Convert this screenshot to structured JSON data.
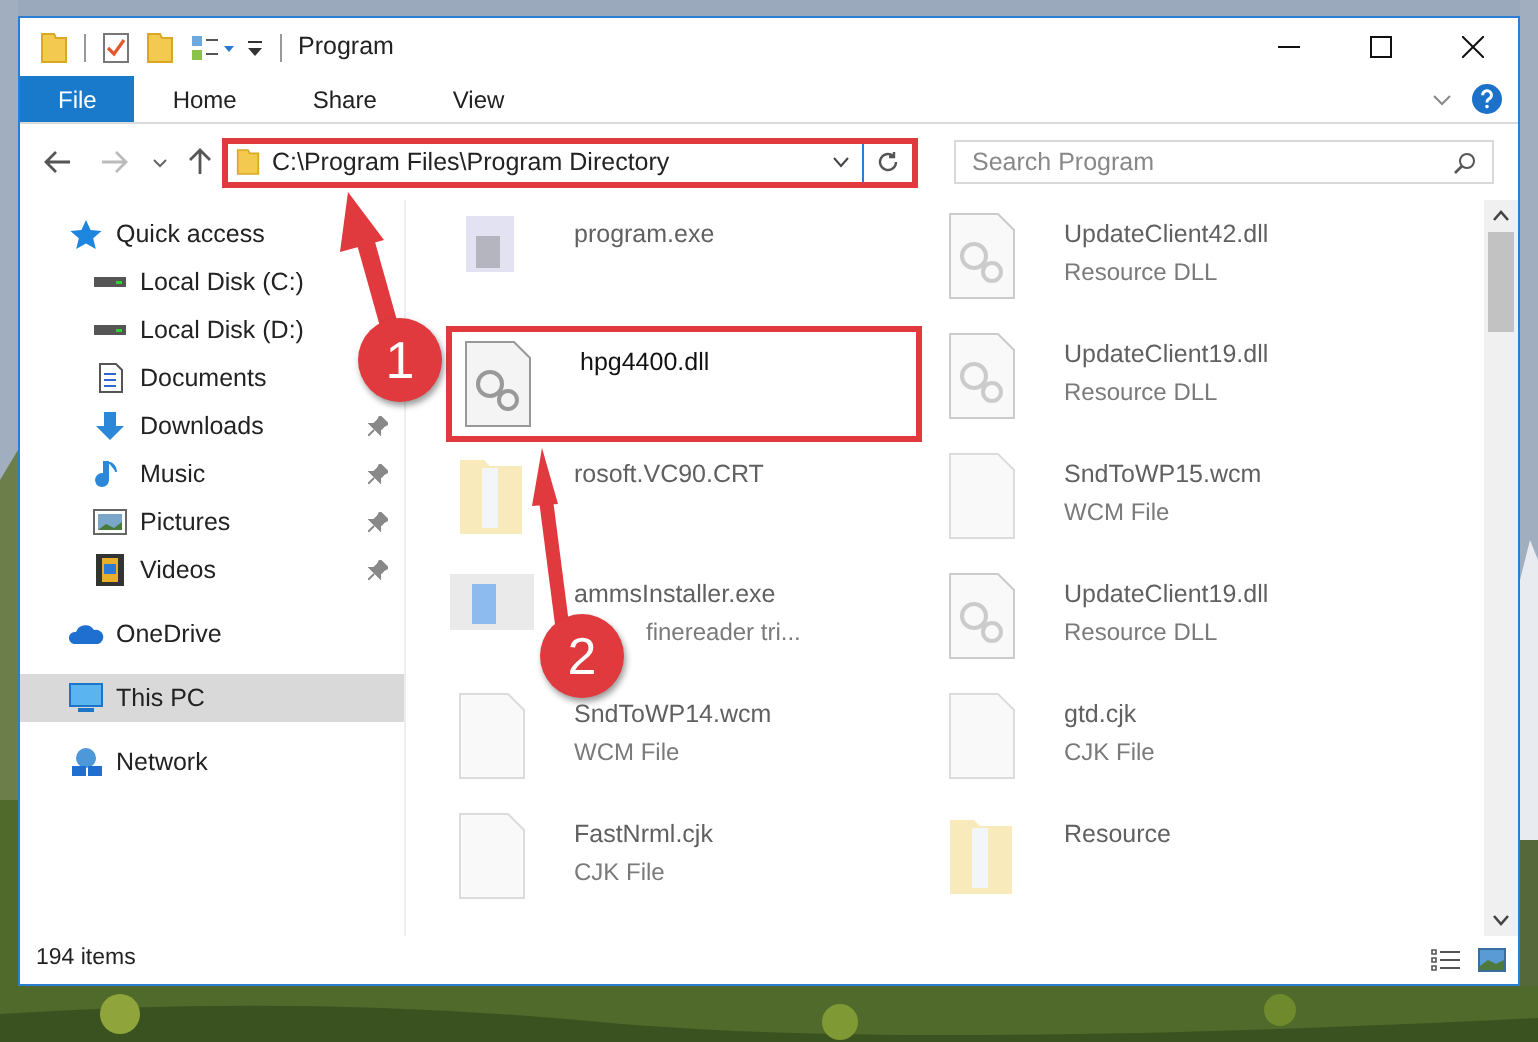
{
  "window": {
    "title": "Program"
  },
  "ribbon": {
    "tabs": [
      {
        "label": "File",
        "selected": true
      },
      {
        "label": "Home",
        "selected": false
      },
      {
        "label": "Share",
        "selected": false
      },
      {
        "label": "View",
        "selected": false
      }
    ]
  },
  "address_bar": {
    "path": "C:\\Program Files\\Program Directory",
    "highlighted": true
  },
  "search": {
    "placeholder": "Search Program"
  },
  "sidebar": {
    "items": [
      {
        "label": "Quick access",
        "selected": false,
        "children": [
          {
            "label": "Local Disk (C:)",
            "pinned": false,
            "selected": false
          },
          {
            "label": "Local Disk (D:)",
            "pinned": false,
            "selected": false
          },
          {
            "label": "Documents",
            "pinned": false,
            "selected": false
          },
          {
            "label": "Downloads",
            "pinned": true,
            "selected": false
          },
          {
            "label": "Music",
            "pinned": true,
            "selected": false
          },
          {
            "label": "Pictures",
            "pinned": true,
            "selected": false
          },
          {
            "label": "Videos",
            "pinned": true,
            "selected": false
          }
        ]
      },
      {
        "label": "OneDrive",
        "selected": false
      },
      {
        "label": "This PC",
        "selected": true
      },
      {
        "label": "Network",
        "selected": false
      }
    ]
  },
  "files": [
    {
      "kind": "exe",
      "name": "program.exe",
      "blurred": true
    },
    {
      "kind": "dll",
      "name": "UpdateClient42.dll",
      "type": "Resource DLL",
      "blurred": true
    },
    {
      "kind": "dll",
      "name": "hpg4400.dll",
      "blurred": false,
      "highlighted": true
    },
    {
      "kind": "dll",
      "name": "UpdateClient19.dll",
      "type": "Resource DLL",
      "blurred": true
    },
    {
      "kind": "folder",
      "name": "rosoft.VC90.CRT",
      "blurred": true
    },
    {
      "kind": "file",
      "name": "SndToWP15.wcm",
      "type": "WCM File",
      "blurred": true
    },
    {
      "kind": "installer",
      "name": "ammsInstaller.exe",
      "type": "finereader tri...",
      "blurred": true
    },
    {
      "kind": "dll",
      "name": "UpdateClient19.dll",
      "type": "Resource DLL",
      "blurred": true
    },
    {
      "kind": "file",
      "name": "SndToWP14.wcm",
      "type": "WCM File",
      "blurred": true
    },
    {
      "kind": "file",
      "name": "gtd.cjk",
      "type": "CJK File",
      "blurred": true
    },
    {
      "kind": "file",
      "name": "FastNrml.cjk",
      "type": "CJK File",
      "blurred": true
    },
    {
      "kind": "folder",
      "name": "Resource",
      "blurred": true
    }
  ],
  "status_bar": {
    "count": "194 items"
  },
  "annotations": [
    {
      "number": "1"
    },
    {
      "number": "2"
    }
  ]
}
